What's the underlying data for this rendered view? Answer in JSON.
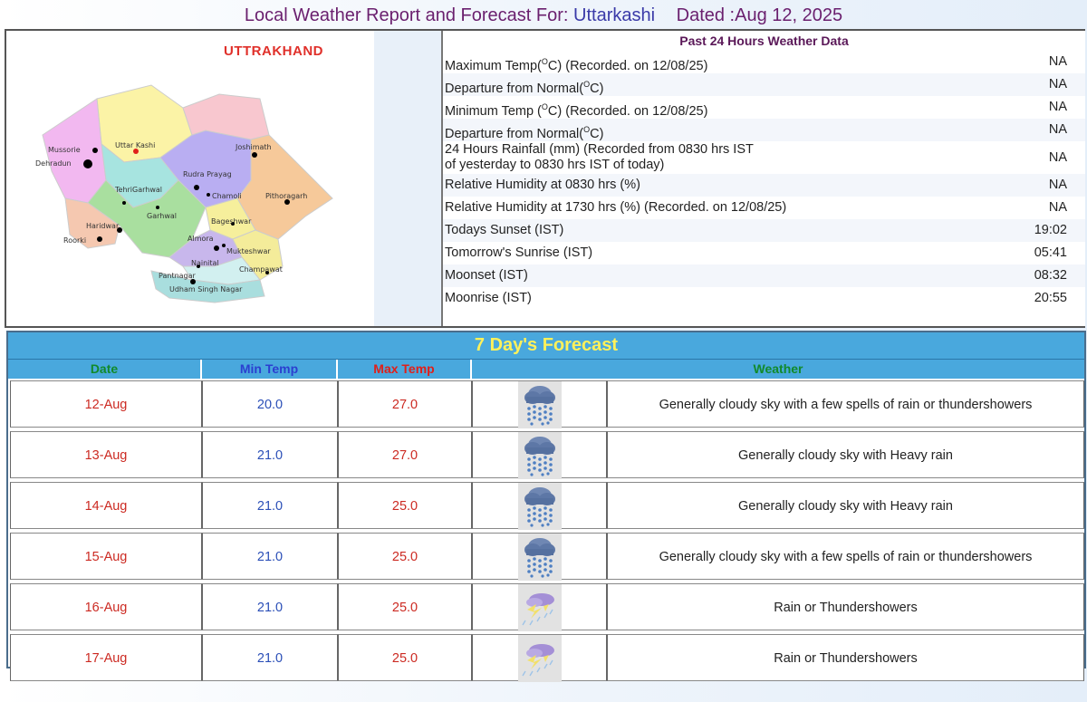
{
  "header": {
    "prefix": "Local Weather Report and Forecast For:",
    "city": "Uttarkashi",
    "dated": "Dated :Aug 12, 2025"
  },
  "map": {
    "state_title": "UTTRAKHAND",
    "labels": {
      "mussorie": "Mussorie",
      "dehradun": "Dehradun",
      "uttarkashi": "Uttar Kashi",
      "joshimath": "Joshimath",
      "rudraprayag": "Rudra Prayag",
      "tehrigarhwal": "TehriGarhwal",
      "chamoli": "Chamoli",
      "pithoragarh": "Pithoragarh",
      "garhwal": "Garhwal",
      "bageshwar": "Bageshwar",
      "haridwar": "Haridwar",
      "roorki": "Roorki",
      "almora": "Almora",
      "mukteshwar": "Mukteshwar",
      "nainital": "Nainital",
      "champawat": "Champawat",
      "pantnagar": "Pantnagar",
      "udhamsinghnagar": "Udham Singh Nagar"
    }
  },
  "past24": {
    "title": "Past 24 Hours Weather Data",
    "rows": [
      {
        "label_a": "Maximum Temp(",
        "sup": "O",
        "label_b": "C) (Recorded. on 12/08/25)",
        "value": "NA"
      },
      {
        "label_a": "Departure from Normal(",
        "sup": "O",
        "label_b": "C)",
        "value": "NA"
      },
      {
        "label_a": "Minimum Temp (",
        "sup": "O",
        "label_b": "C) (Recorded. on 12/08/25)",
        "value": "NA"
      },
      {
        "label_a": "Departure from Normal(",
        "sup": "O",
        "label_b": "C)",
        "value": "NA"
      },
      {
        "line1": "24 Hours Rainfall (mm) (Recorded from 0830 hrs IST",
        "line2": "of yesterday to 0830 hrs IST of today)",
        "value": "NA"
      },
      {
        "label": "Relative Humidity at 0830 hrs (%)",
        "value": "NA"
      },
      {
        "label": "Relative Humidity at 1730 hrs (%) (Recorded. on 12/08/25)",
        "value": "NA"
      },
      {
        "label": "Todays Sunset (IST)",
        "value": "19:02"
      },
      {
        "label": "Tomorrow's Sunrise (IST)",
        "value": "05:41"
      },
      {
        "label": "Moonset (IST)",
        "value": "08:32"
      },
      {
        "label": "Moonrise (IST)",
        "value": "20:55"
      }
    ]
  },
  "forecast": {
    "title": "7 Day's Forecast",
    "headers": {
      "date": "Date",
      "min": "Min Temp",
      "max": "Max Temp",
      "weather": "Weather"
    },
    "header_colors": {
      "date": "#118a2a",
      "min": "#2b3fd0",
      "max": "#e0201a",
      "weather": "#118a2a"
    },
    "rows": [
      {
        "date": "12-Aug",
        "min": "20.0",
        "max": "27.0",
        "icon": "rain-cloud-icon",
        "desc": "Generally cloudy sky with a few spells of rain or thundershowers"
      },
      {
        "date": "13-Aug",
        "min": "21.0",
        "max": "27.0",
        "icon": "rain-cloud-icon",
        "desc": "Generally cloudy sky with Heavy rain"
      },
      {
        "date": "14-Aug",
        "min": "21.0",
        "max": "25.0",
        "icon": "rain-cloud-icon",
        "desc": "Generally cloudy sky with Heavy rain"
      },
      {
        "date": "15-Aug",
        "min": "21.0",
        "max": "25.0",
        "icon": "rain-cloud-icon",
        "desc": "Generally cloudy sky with a few spells of rain or thundershowers"
      },
      {
        "date": "16-Aug",
        "min": "21.0",
        "max": "25.0",
        "icon": "thunder-rain-icon",
        "desc": "Rain or Thundershowers"
      },
      {
        "date": "17-Aug",
        "min": "21.0",
        "max": "25.0",
        "icon": "thunder-rain-icon",
        "desc": "Rain or Thundershowers"
      }
    ]
  },
  "colors": {
    "header_text": "#6a1f6e",
    "city_text": "#3a3aa8",
    "forecast_bar": "#49a8dd",
    "forecast_title": "#fff15a",
    "date_text": "#cc2a22",
    "min_text": "#2b4fb7"
  }
}
